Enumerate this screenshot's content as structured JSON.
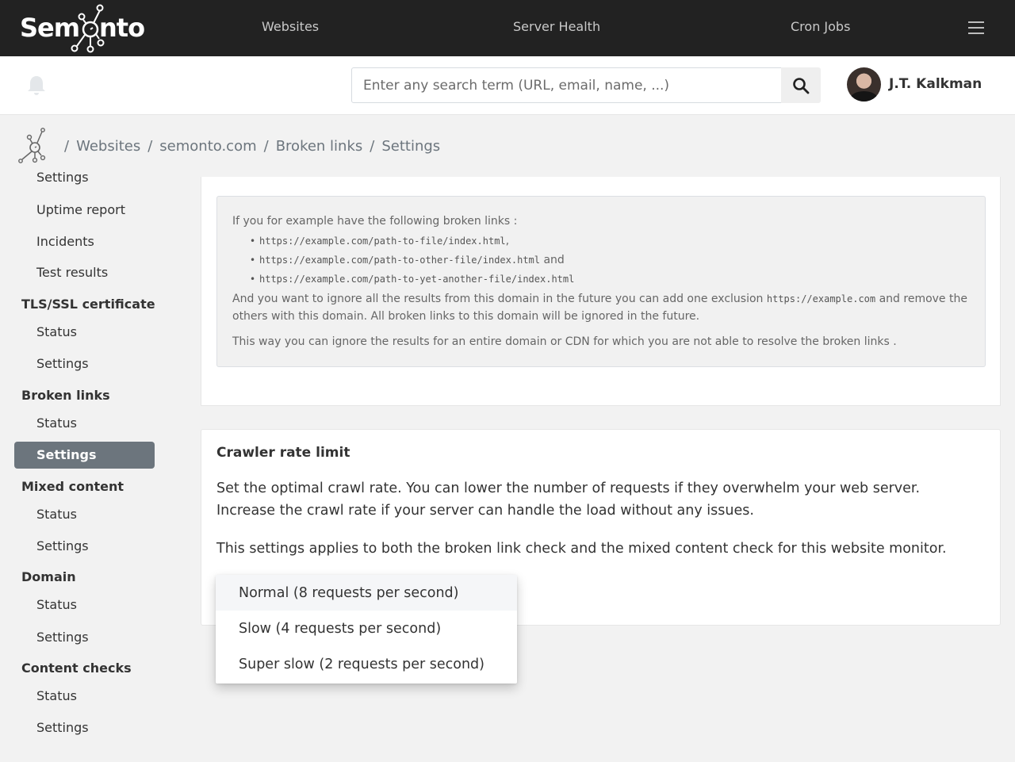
{
  "app": {
    "brand": "Semonto"
  },
  "topnav": {
    "links": [
      {
        "label": "Websites"
      },
      {
        "label": "Server Health"
      },
      {
        "label": "Cron Jobs"
      }
    ],
    "menu_icon": "hamburger-icon"
  },
  "header": {
    "notifications_icon": "bell-icon",
    "search": {
      "value": "",
      "placeholder": "Enter any search term (URL, email, name, ...)",
      "button_icon": "search-icon"
    },
    "user": {
      "name": "J.T. Kalkman",
      "avatar_icon": "user-avatar"
    }
  },
  "breadcrumb": {
    "home_icon": "semonto-home-icon",
    "separator": "/",
    "items": [
      "Websites",
      "semonto.com",
      "Broken links",
      "Settings"
    ]
  },
  "sidebar": {
    "items": [
      {
        "type": "item",
        "label": "Settings"
      },
      {
        "type": "item",
        "label": "Uptime report"
      },
      {
        "type": "item",
        "label": "Incidents"
      },
      {
        "type": "item",
        "label": "Test results"
      },
      {
        "type": "group",
        "label": "TLS/SSL certificate"
      },
      {
        "type": "item",
        "label": "Status"
      },
      {
        "type": "item",
        "label": "Settings"
      },
      {
        "type": "group",
        "label": "Broken links"
      },
      {
        "type": "item",
        "label": "Status"
      },
      {
        "type": "item",
        "label": "Settings",
        "active": true
      },
      {
        "type": "group",
        "label": "Mixed content"
      },
      {
        "type": "item",
        "label": "Status"
      },
      {
        "type": "item",
        "label": "Settings"
      },
      {
        "type": "group",
        "label": "Domain"
      },
      {
        "type": "item",
        "label": "Status"
      },
      {
        "type": "item",
        "label": "Settings"
      },
      {
        "type": "group",
        "label": "Content checks"
      },
      {
        "type": "item",
        "label": "Status"
      },
      {
        "type": "item",
        "label": "Settings"
      }
    ]
  },
  "info_box": {
    "intro": "If you for example have the following broken links :",
    "links": [
      {
        "url": "https://example.com/path-to-file/index.html",
        "suffix": ","
      },
      {
        "url": "https://example.com/path-to-other-file/index.html",
        "suffix": " and"
      },
      {
        "url": "https://example.com/path-to-yet-another-file/index.html",
        "suffix": ""
      }
    ],
    "para2_before": "And you want to ignore all the results from this domain in the future you can add one exclusion ",
    "para2_code": "https://example.com",
    "para2_after": " and remove the others with this domain. All broken links to this domain will be ignored in the future.",
    "para3": "This way you can ignore the results for an entire domain or CDN for which you are not able to resolve the broken links ."
  },
  "crawler": {
    "title": "Crawler rate limit",
    "description": "Set the optimal crawl rate. You can lower the number of requests if they overwhelm your web server. Increase the crawl rate if your server can handle the load without any issues.",
    "note": "This settings applies to both the broken link check and the mixed content check for this website monitor.",
    "select": {
      "selected": "Normal (8 requests per second)",
      "options": [
        "Normal (8 requests per second)",
        "Slow (4 requests per second)",
        "Super slow (2 requests per second)"
      ],
      "highlighted_index": 0
    }
  },
  "colors": {
    "topnav_bg": "#222222",
    "active_sidebar_bg": "#6c757d",
    "page_bg": "#f2f2f2",
    "info_box_bg": "#f1f1f1"
  }
}
